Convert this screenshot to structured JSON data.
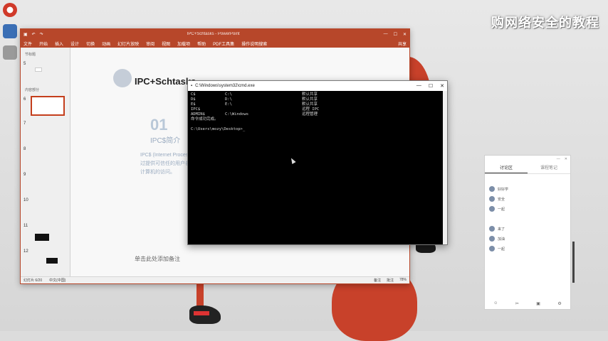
{
  "watermark": "购网络安全的教程",
  "ppt": {
    "title": "IPC+Schtasks - PowerPoint",
    "share_label": "共享",
    "menu": [
      "文件",
      "开始",
      "插入",
      "设计",
      "切换",
      "动画",
      "幻灯片放映",
      "审阅",
      "视图",
      "加载项",
      "帮助",
      "PDF工具集",
      "操作说明搜索"
    ],
    "thumbs": {
      "section1": "节标题",
      "section2": "内容部分",
      "numbers": [
        "5",
        "6",
        "7",
        "8",
        "9",
        "10",
        "11",
        "12"
      ]
    },
    "slide": {
      "title": "IPC+Schtasks",
      "num": "01",
      "subtitle": "IPC$简介",
      "p1": "IPC$ (Internet Process Connection)是",
      "p2": "过提供可信任的用户名和口令，建",
      "p3": "计算机的访问。"
    },
    "notes": "单击此处添加备注",
    "status": {
      "left": "幻灯片 6/20",
      "lang": "中文(中国)",
      "notes_btn": "备注",
      "comments_btn": "批注",
      "zoom": "78%"
    }
  },
  "cmd": {
    "title": "C:\\Windows\\system32\\cmd.exe",
    "rows": [
      [
        "C$",
        "C:\\",
        "默认共享"
      ],
      [
        "D$",
        "D:\\",
        "默认共享"
      ],
      [
        "E$",
        "E:\\",
        "默认共享"
      ],
      [
        "IPC$",
        "",
        "远程 IPC"
      ],
      [
        "ADMIN$",
        "C:\\Windows",
        "远程管理"
      ]
    ],
    "success": "命令成功完成。",
    "prompt": "C:\\Users\\mozy\\Desktop>_"
  },
  "panel": {
    "tabs": [
      "讨论区",
      "课程笔记"
    ],
    "items": [
      "",
      "好好学",
      "安全",
      "一起",
      "",
      "来了",
      "加油",
      "一起"
    ],
    "bottom": [
      "",
      "",
      "",
      ""
    ]
  }
}
